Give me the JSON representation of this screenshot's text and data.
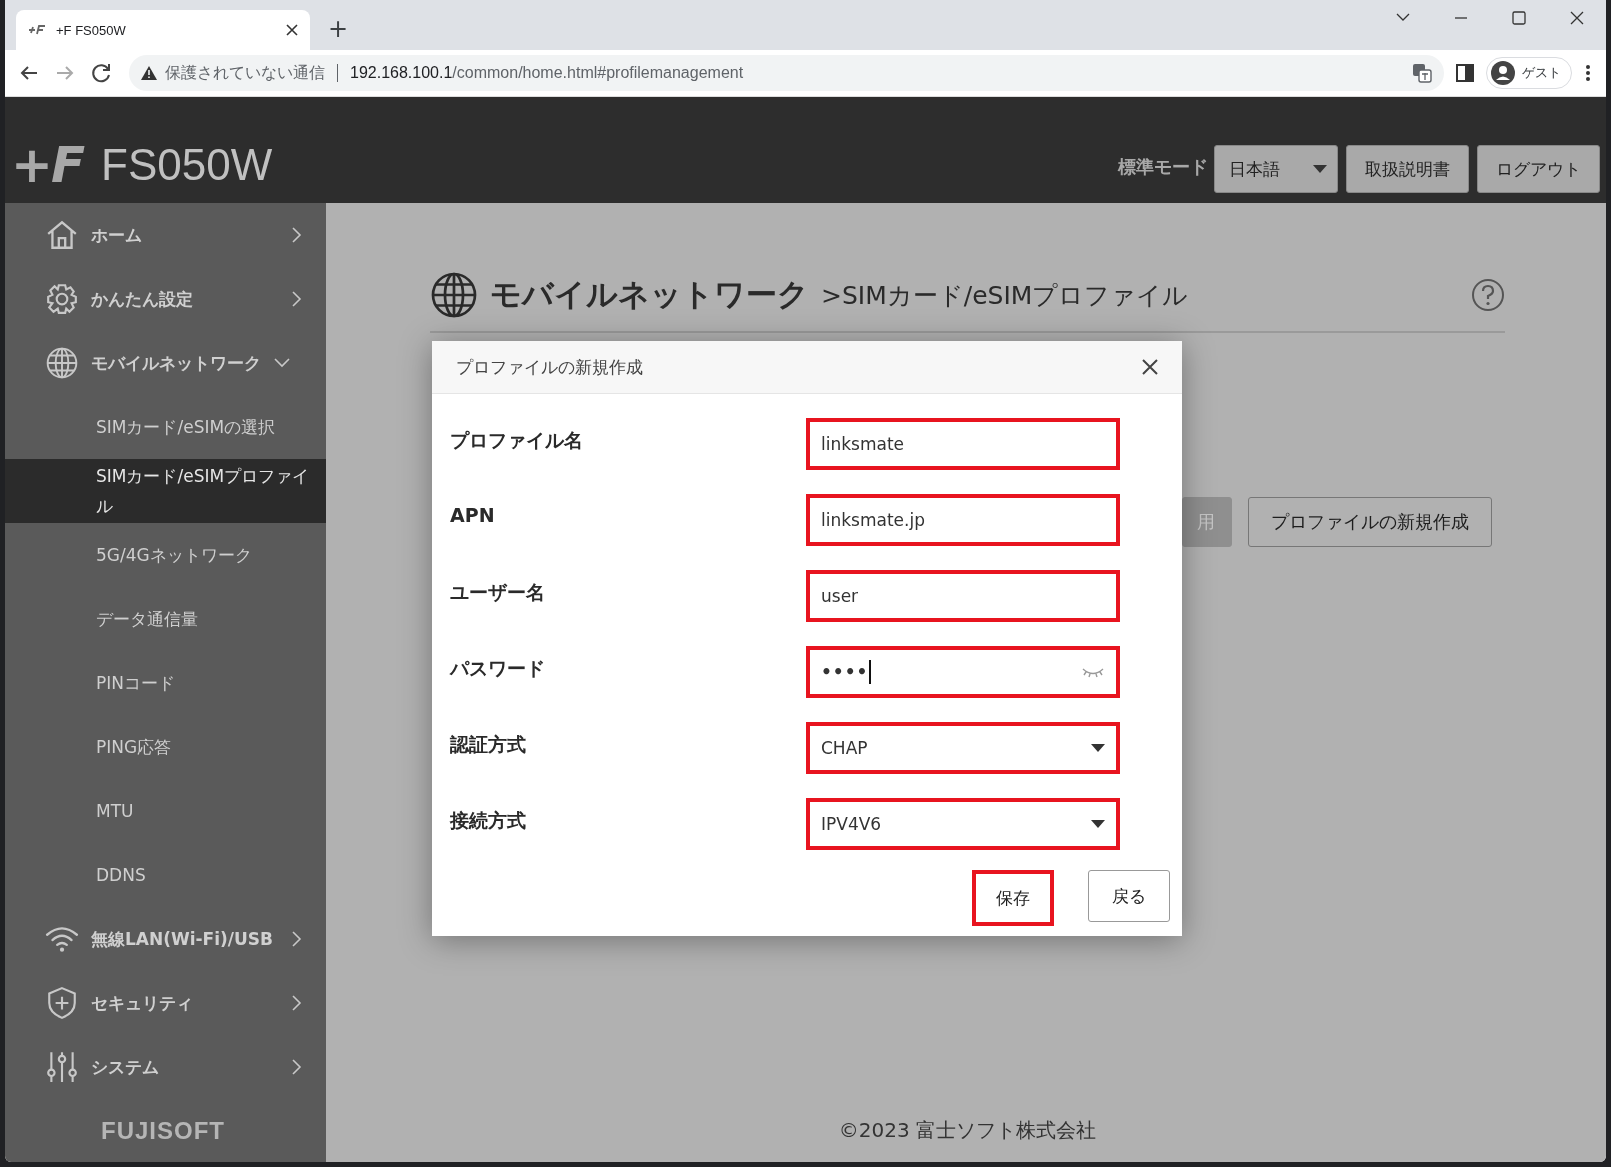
{
  "browser": {
    "tab_title": "+F FS050W",
    "new_tab": "+",
    "url_warning": "保護されていない通信",
    "url_host": "192.168.100.1",
    "url_path": "/common/home.html#profilemanagement",
    "profile": "ゲスト"
  },
  "header": {
    "logo": "+F",
    "product": "FS050W",
    "mode_label": "標準モード",
    "language": "日本語",
    "buttons": [
      "取扱説明書",
      "ログアウト"
    ]
  },
  "sidebar": {
    "items": [
      {
        "label": "ホーム",
        "kind": "home",
        "expanded": false
      },
      {
        "label": "かんたん設定",
        "kind": "gear",
        "expanded": false
      },
      {
        "label": "モバイルネットワーク",
        "kind": "globe",
        "expanded": true,
        "children": [
          {
            "label": "SIMカード/eSIMの選択",
            "selected": false
          },
          {
            "label": "SIMカード/eSIMプロファイル",
            "selected": true
          },
          {
            "label": "5G/4Gネットワーク",
            "selected": false
          },
          {
            "label": "データ通信量",
            "selected": false
          },
          {
            "label": "PINコード",
            "selected": false
          },
          {
            "label": "PING応答",
            "selected": false
          },
          {
            "label": "MTU",
            "selected": false
          },
          {
            "label": "DDNS",
            "selected": false
          }
        ]
      },
      {
        "label": "無線LAN(Wi-Fi)/USB",
        "kind": "wifi",
        "expanded": false
      },
      {
        "label": "セキュリティ",
        "kind": "shield",
        "expanded": false
      },
      {
        "label": "システム",
        "kind": "sliders",
        "expanded": false
      }
    ],
    "brand": "FUJISOFT"
  },
  "page": {
    "title": "モバイルネットワーク",
    "subtitle": ">SIMカード/eSIMプロファイル",
    "buttons": [
      {
        "label": "用",
        "disabled": true
      },
      {
        "label": "プロファイルの新規作成",
        "disabled": false
      }
    ]
  },
  "dialog": {
    "title": "プロファイルの新規作成",
    "fields": [
      {
        "label": "プロファイル名",
        "kind": "text",
        "value": "linksmate",
        "highlighted": true
      },
      {
        "label": "APN",
        "kind": "text",
        "value": "linksmate.jp",
        "highlighted": true
      },
      {
        "label": "ユーザー名",
        "kind": "text",
        "value": "user",
        "highlighted": true
      },
      {
        "label": "パスワード",
        "kind": "password",
        "value": "••••",
        "highlighted": true
      },
      {
        "label": "認証方式",
        "kind": "select",
        "value": "CHAP",
        "highlighted": true
      },
      {
        "label": "接続方式",
        "kind": "select",
        "value": "IPV4V6",
        "highlighted": true
      }
    ],
    "buttons": [
      {
        "label": "保存",
        "highlighted": true
      },
      {
        "label": "戻る",
        "highlighted": false
      }
    ]
  },
  "footer": "©2023 富士ソフト株式会社"
}
